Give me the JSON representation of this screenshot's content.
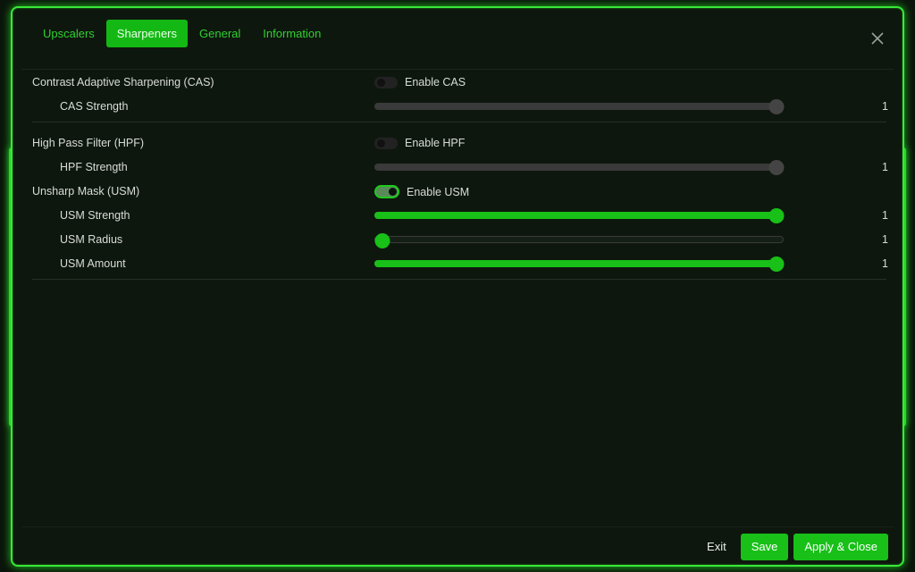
{
  "tabs": [
    {
      "label": "Upscalers",
      "active": false
    },
    {
      "label": "Sharpeners",
      "active": true
    },
    {
      "label": "General",
      "active": false
    },
    {
      "label": "Information",
      "active": false
    }
  ],
  "close_icon": "close-icon",
  "sections": {
    "cas": {
      "title": "Contrast Adaptive Sharpening (CAS)",
      "toggle_label": "Enable CAS",
      "enabled": false,
      "strength": {
        "label": "CAS Strength",
        "value": "1",
        "level": 1.0
      }
    },
    "hpf": {
      "title": "High Pass Filter (HPF)",
      "toggle_label": "Enable HPF",
      "enabled": false,
      "strength": {
        "label": "HPF Strength",
        "value": "1",
        "level": 1.0
      }
    },
    "usm": {
      "title": "Unsharp Mask (USM)",
      "toggle_label": "Enable USM",
      "enabled": true,
      "strength": {
        "label": "USM Strength",
        "value": "1",
        "level": 1.0
      },
      "radius": {
        "label": "USM Radius",
        "value": "1",
        "level": 0.02
      },
      "amount": {
        "label": "USM Amount",
        "value": "1",
        "level": 1.0
      }
    }
  },
  "footer": {
    "exit_label": "Exit",
    "save_label": "Save",
    "apply_label": "Apply & Close"
  },
  "colors": {
    "accent": "#18c018",
    "border": "#39e839",
    "background": "#0e170e"
  }
}
